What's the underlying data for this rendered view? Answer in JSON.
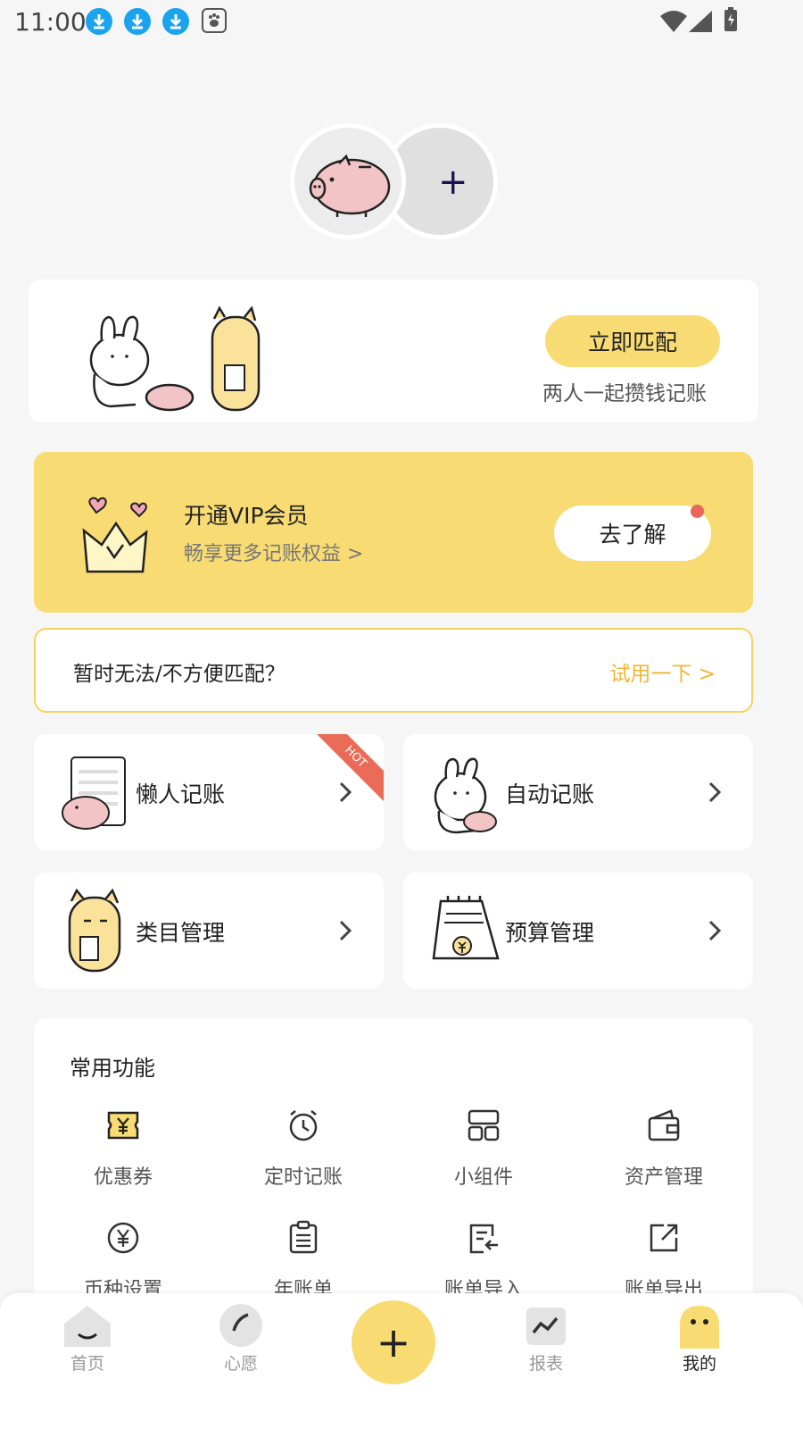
{
  "status_bar": {
    "time": "11:00"
  },
  "match": {
    "button_label": "立即匹配",
    "subtitle": "两人一起攒钱记账"
  },
  "vip": {
    "title": "开通VIP会员",
    "subtitle": "畅享更多记账权益 >",
    "button_label": "去了解"
  },
  "trial": {
    "text": "暂时无法/不方便匹配？",
    "link": "试用一下 >"
  },
  "features": [
    {
      "label": "懒人记账",
      "badge": "HOT"
    },
    {
      "label": "自动记账"
    },
    {
      "label": "类目管理"
    },
    {
      "label": "预算管理"
    }
  ],
  "common": {
    "title": "常用功能",
    "tools": [
      {
        "label": "优惠券",
        "icon": "coupon-icon"
      },
      {
        "label": "定时记账",
        "icon": "alarm-clock-icon"
      },
      {
        "label": "小组件",
        "icon": "widget-icon"
      },
      {
        "label": "资产管理",
        "icon": "wallet-icon"
      },
      {
        "label": "币种设置",
        "icon": "currency-icon"
      },
      {
        "label": "年账单",
        "icon": "clipboard-icon"
      },
      {
        "label": "账单导入",
        "icon": "import-icon"
      },
      {
        "label": "账单导出",
        "icon": "export-icon"
      }
    ]
  },
  "nav": [
    {
      "label": "首页"
    },
    {
      "label": "心愿"
    },
    {
      "label": "+"
    },
    {
      "label": "报表"
    },
    {
      "label": "我的"
    }
  ],
  "colors": {
    "accent": "#f8dc73",
    "link": "#f0b731",
    "hot": "#ea6b57",
    "download": "#1aa3ee"
  }
}
